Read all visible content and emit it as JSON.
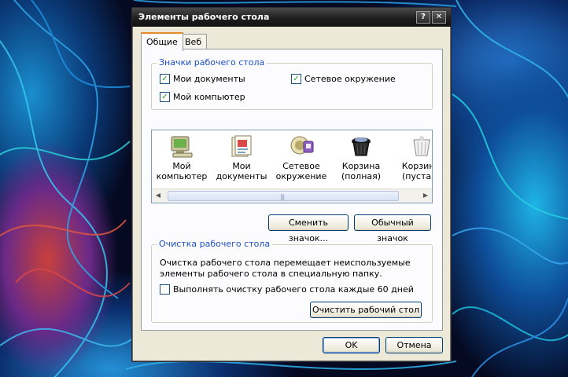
{
  "window": {
    "title": "Элементы рабочего стола",
    "help_label": "?",
    "close_label": "✕"
  },
  "tabs": [
    {
      "label": "Общие",
      "active": true
    },
    {
      "label": "Веб",
      "active": false
    }
  ],
  "desktop_icons_group": {
    "legend": "Значки рабочего стола",
    "checkboxes": [
      {
        "label": "Мои документы",
        "checked": true
      },
      {
        "label": "Сетевое окружение",
        "checked": true
      },
      {
        "label": "Мой компьютер",
        "checked": true
      }
    ]
  },
  "icon_list": [
    {
      "line1": "Мой",
      "line2": "компьютер",
      "icon": "my-computer-icon"
    },
    {
      "line1": "Мои",
      "line2": "документы",
      "icon": "my-documents-icon"
    },
    {
      "line1": "Сетевое",
      "line2": "окружение",
      "icon": "network-icon"
    },
    {
      "line1": "Корзина",
      "line2": "(полная)",
      "icon": "recycle-bin-full-icon"
    },
    {
      "line1": "Корзина",
      "line2": "(пустая)",
      "icon": "recycle-bin-empty-icon"
    }
  ],
  "icon_buttons": {
    "change_icon": "Сменить значок...",
    "default_icon": "Обычный значок"
  },
  "cleanup_group": {
    "legend": "Очистка рабочего стола",
    "description": "Очистка рабочего стола перемещает неиспользуемые элементы рабочего стола в специальную папку.",
    "checkbox_label": "Выполнять очистку рабочего стола каждые 60 дней",
    "checkbox_checked": false,
    "clean_button": "Очистить рабочий стол"
  },
  "footer": {
    "ok": "OK",
    "cancel": "Отмена"
  },
  "colors": {
    "legend_blue": "#1b4fc4",
    "tab_accent": "#e68b2c",
    "titlebar": "#1f1f1f"
  }
}
